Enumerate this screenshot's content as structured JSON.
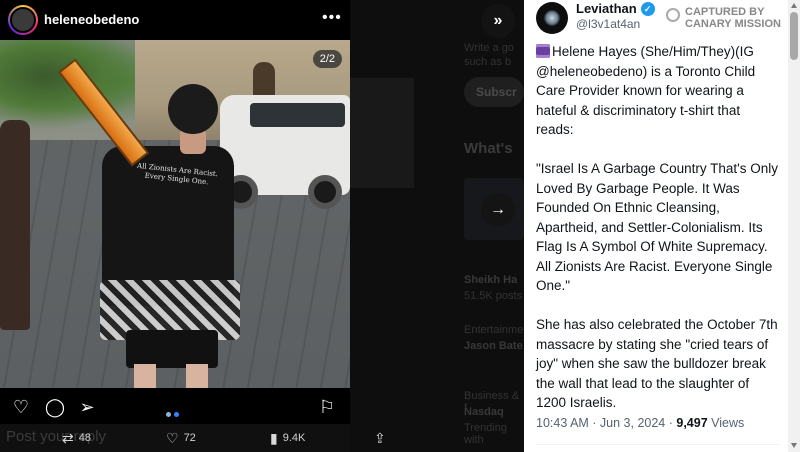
{
  "instagram": {
    "username": "heleneobedeno",
    "photo_counter": "2/2",
    "shirt_text": "All Zionists Are Racist. Every Single One.",
    "post_placeholder": "Post your reply"
  },
  "background_page": {
    "text_line_1": "Write a go",
    "text_line_2": "such as b",
    "subscribe_label": "Subscr",
    "whats_label": "What's",
    "item1_name": "Sheikh Ha",
    "item1_meta": "51.5K posts",
    "item2_meta": "Entertainment",
    "item2_name": "Jason Bate",
    "item3_meta": "Business & f",
    "item3_name": "Nasdaq",
    "item3_sub": "Trending with"
  },
  "stats": {
    "retweets": "48",
    "likes": "72",
    "views": "9.4K"
  },
  "tweet": {
    "display_name": "Leviathan",
    "handle": "@l3v1at4an",
    "watermark": "CAPTURED BY CANARY MISSION",
    "paragraph_1": "Helene Hayes (She/Him/They)(IG @heleneobedeno) is a Toronto Child Care Provider known for wearing a hateful & discriminatory t-shirt that reads:",
    "paragraph_2": "\"Israel Is A Garbage Country That's Only Loved By Garbage People. It Was Founded On Ethnic Cleansing, Apartheid, and Settler-Colonialism. Its Flag Is A Symbol Of White Supremacy. All Zionists Are Racist. Everyone Single One.\"",
    "paragraph_3": "She has also celebrated the October 7th massacre by stating she \"cried tears of joy\" when she saw the bulldozer break the wall that lead to the slaughter of 1200 Israelis.",
    "timestamp": "10:43 AM · Jun 3, 2024 · ",
    "views_count": "9,497",
    "views_label": " Views"
  },
  "colors": {
    "verified": "#1d9bf0",
    "carousel_dot": "#3b82f6"
  },
  "icons": [
    "more-icon",
    "heart-icon",
    "comment-icon",
    "share-icon",
    "bookmark-icon",
    "retweet-icon",
    "views-icon",
    "upload-icon",
    "next-arrow-icon",
    "fast-forward-icon",
    "verified-icon"
  ]
}
